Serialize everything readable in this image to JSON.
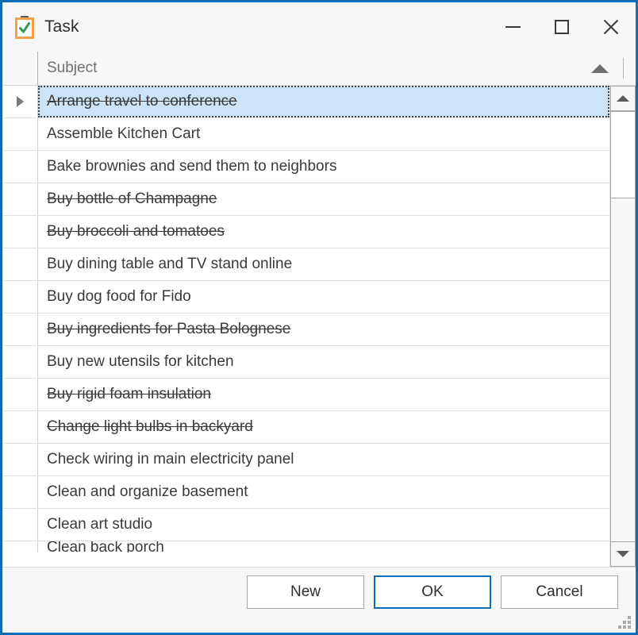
{
  "window": {
    "title": "Task",
    "icon": "clipboard-check-icon",
    "border_color": "#0c6cb8",
    "chrome_color": "#f7f7f7",
    "controls": {
      "minimize": "minimize-icon",
      "maximize": "maximize-icon",
      "close": "close-icon"
    }
  },
  "list": {
    "column_header": {
      "label": "Subject",
      "sort_direction": "ascending",
      "sort_icon": "sort-ascending-icon"
    },
    "selection_color": "#cce4f7",
    "rows": [
      {
        "subject": "Arrange travel to conference",
        "completed": true,
        "selected": true,
        "clipped": false
      },
      {
        "subject": "Assemble Kitchen Cart",
        "completed": false,
        "selected": false,
        "clipped": false
      },
      {
        "subject": "Bake brownies and send them to neighbors",
        "completed": false,
        "selected": false,
        "clipped": false
      },
      {
        "subject": "Buy bottle of Champagne",
        "completed": true,
        "selected": false,
        "clipped": false
      },
      {
        "subject": "Buy broccoli and tomatoes",
        "completed": true,
        "selected": false,
        "clipped": false
      },
      {
        "subject": "Buy dining table and TV stand online",
        "completed": false,
        "selected": false,
        "clipped": false
      },
      {
        "subject": "Buy dog food for Fido",
        "completed": false,
        "selected": false,
        "clipped": false
      },
      {
        "subject": "Buy ingredients for Pasta Bolognese",
        "completed": true,
        "selected": false,
        "clipped": false
      },
      {
        "subject": "Buy new utensils for kitchen",
        "completed": false,
        "selected": false,
        "clipped": false
      },
      {
        "subject": "Buy rigid foam insulation",
        "completed": true,
        "selected": false,
        "clipped": false
      },
      {
        "subject": "Change light bulbs in backyard",
        "completed": true,
        "selected": false,
        "clipped": false
      },
      {
        "subject": "Check wiring in main electricity panel",
        "completed": false,
        "selected": false,
        "clipped": false
      },
      {
        "subject": "Clean and organize basement",
        "completed": false,
        "selected": false,
        "clipped": false
      },
      {
        "subject": "Clean art studio",
        "completed": false,
        "selected": false,
        "clipped": false
      },
      {
        "subject": "Clean back porch",
        "completed": false,
        "selected": false,
        "clipped": true
      }
    ]
  },
  "scrollbar": {
    "up_icon": "scroll-up-arrow-icon",
    "down_icon": "scroll-down-arrow-icon",
    "orientation": "vertical"
  },
  "footer": {
    "buttons": [
      {
        "label": "New",
        "default": false
      },
      {
        "label": "OK",
        "default": true
      },
      {
        "label": "Cancel",
        "default": false
      }
    ],
    "resize_grip": "resize-grip-icon"
  }
}
